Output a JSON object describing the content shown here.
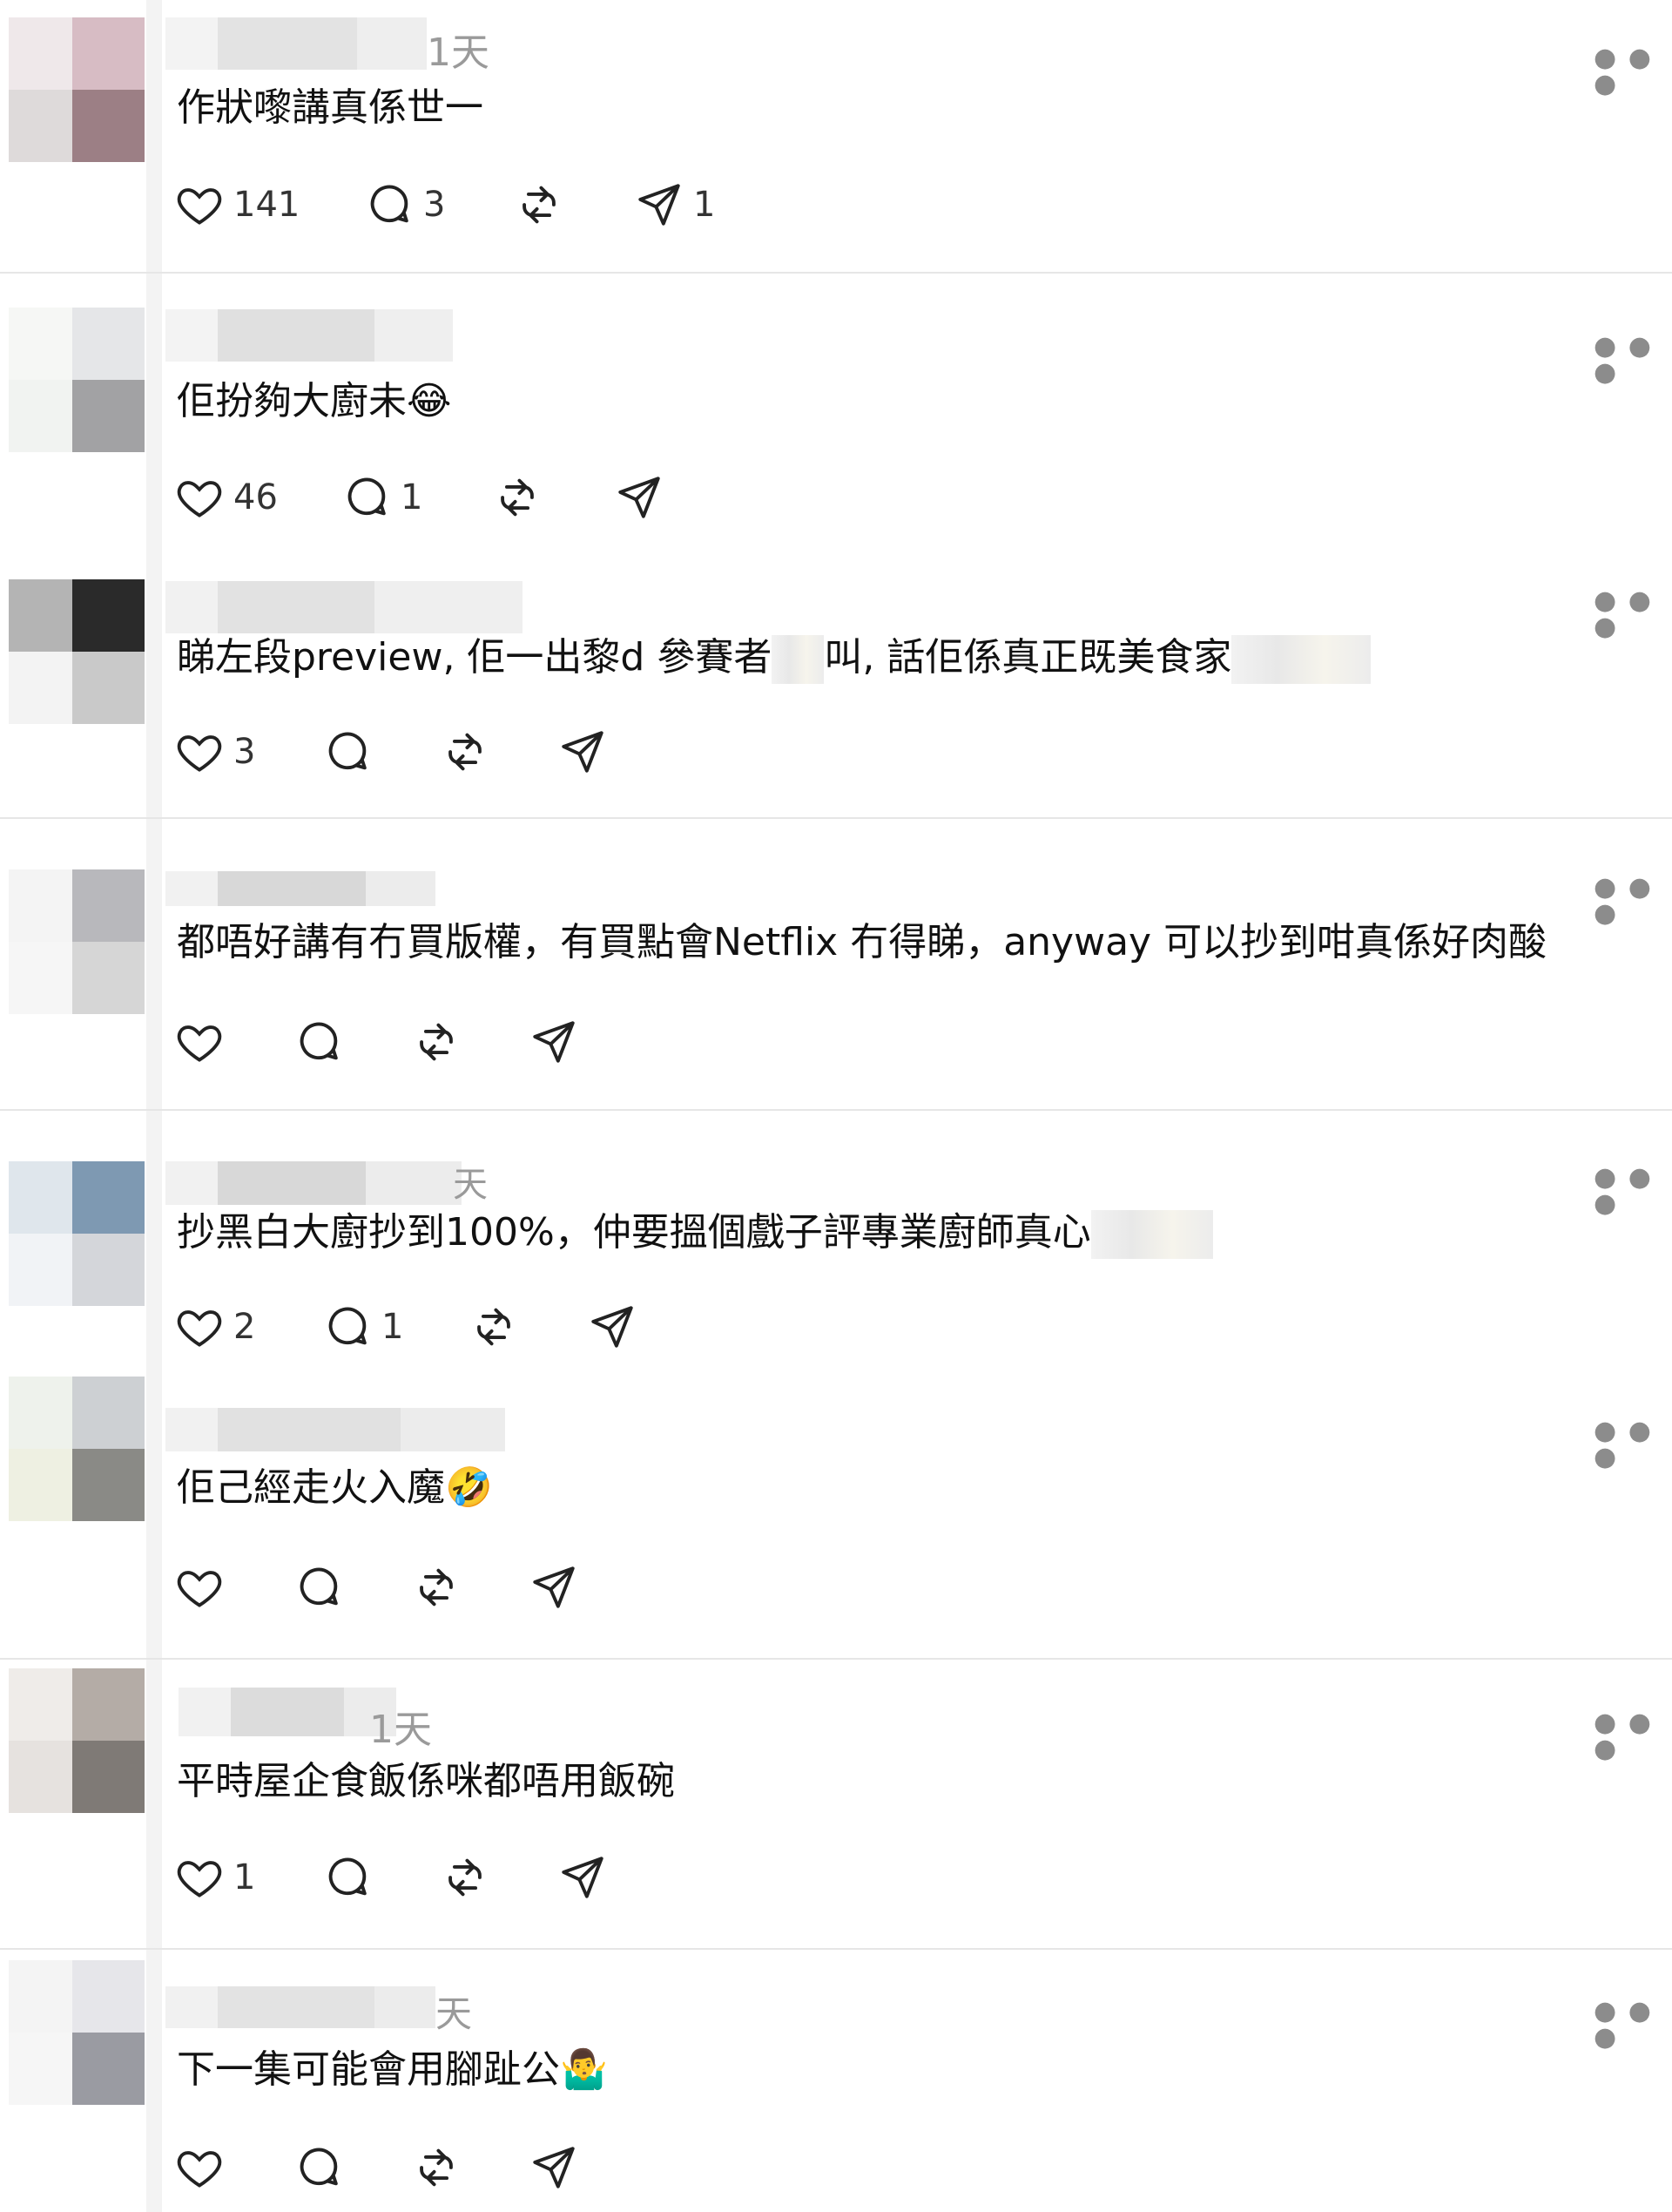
{
  "posts": [
    {
      "time": "1天",
      "text": "作狀嚟講真係世一",
      "likes": "141",
      "replies": "3",
      "reposts": "",
      "shares": "1"
    },
    {
      "time": "",
      "text": "佢扮夠大廚未",
      "emoji": "😂",
      "likes": "46",
      "replies": "1",
      "reposts": "",
      "shares": ""
    },
    {
      "time": "",
      "text": "睇左段preview, 佢一出黎d 參賽者",
      "text2": "叫, 話佢係真正既美食家",
      "likes": "3",
      "replies": "",
      "reposts": "",
      "shares": ""
    },
    {
      "time": "",
      "text": "都唔好講有冇買版權，有買點會Netflix 冇得睇，anyway 可以抄到咁真係好肉酸",
      "likes": "",
      "replies": "",
      "reposts": "",
      "shares": ""
    },
    {
      "time": "天",
      "text": "抄黑白大廚抄到100%，仲要搵個戲子評專業廚師真心",
      "likes": "2",
      "replies": "1",
      "reposts": "",
      "shares": ""
    },
    {
      "time": "",
      "text": "佢己經走火入魔",
      "emoji": "🤣",
      "likes": "",
      "replies": "",
      "reposts": "",
      "shares": ""
    },
    {
      "time": "1天",
      "text": "平時屋企食飯係咪都唔用飯碗",
      "likes": "1",
      "replies": "",
      "reposts": "",
      "shares": ""
    },
    {
      "time": "天",
      "text": "下一集可能會用腳趾公",
      "emoji": "🤷‍♂️",
      "likes": "",
      "replies": "",
      "reposts": "",
      "shares": ""
    }
  ],
  "icons": {
    "more": "more-horizontal-icon",
    "like": "heart-icon",
    "reply": "comment-icon",
    "repost": "repost-icon",
    "share": "send-icon"
  },
  "colors": {
    "divider": "#e6e6e6",
    "text": "#111111",
    "muted": "#9a9a9a",
    "icon": "#222222"
  }
}
